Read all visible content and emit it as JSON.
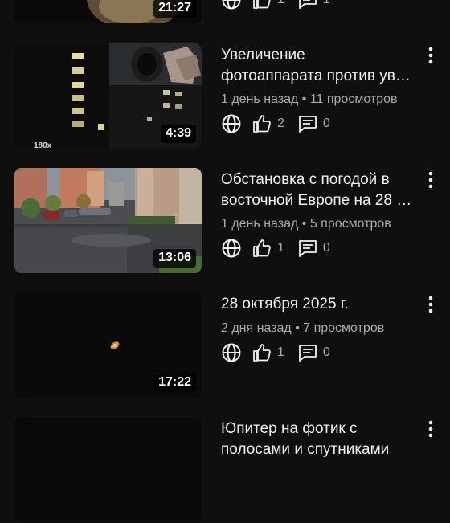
{
  "videos": [
    {
      "title_line1": "",
      "title_line2": "",
      "meta": "",
      "duration": "21:27",
      "likes": "1",
      "comments": "1"
    },
    {
      "title_line1": "Увеличение",
      "title_line2": "фотоаппарата против ув…",
      "meta": "1 день назад • 11 просмотров",
      "duration": "4:39",
      "likes": "2",
      "comments": "0",
      "thumb_overlay_text": "180х"
    },
    {
      "title_line1": "Обстановка с погодой в",
      "title_line2": "восточной Европе на 28 …",
      "meta": "1 день назад • 5 просмотров",
      "duration": "13:06",
      "likes": "1",
      "comments": "0"
    },
    {
      "title_line1": "28 октября 2025 г.",
      "title_line2": "",
      "meta": "2 дня назад • 7 просмотров",
      "duration": "17:22",
      "likes": "1",
      "comments": "0"
    },
    {
      "title_line1": "Юпитер на фотик с",
      "title_line2": "полосами и спутниками",
      "meta": "",
      "duration": "",
      "likes": "",
      "comments": ""
    }
  ],
  "icons": {
    "visibility": "globe-icon",
    "like": "thumb-up-icon",
    "comment": "comment-icon",
    "menu": "more-vert-icon"
  },
  "colors": {
    "background": "#0f0f0f",
    "text_primary": "#f1f1f1",
    "text_secondary": "#aaaaaa"
  }
}
